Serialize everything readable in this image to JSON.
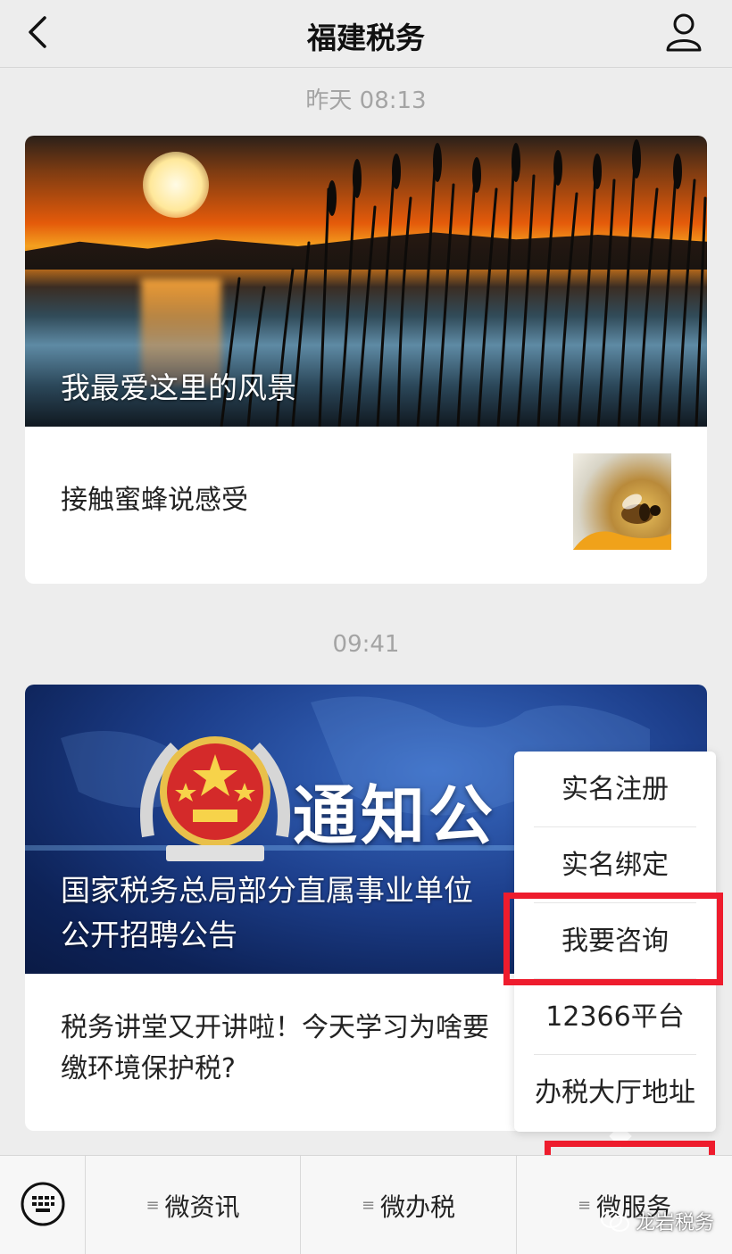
{
  "header": {
    "title": "福建税务",
    "back_icon": "chevron-left-icon",
    "profile_icon": "person-icon"
  },
  "feed": [
    {
      "time": "昨天 08:13",
      "hero_title": "我最爱这里的风景",
      "sub_title": "接触蜜蜂说感受"
    },
    {
      "time": "09:41",
      "hero_title_line1": "国家税务总局部分直属事业单位",
      "hero_title_line2": "公开招聘公告",
      "hero_banner_text": "通知公",
      "sub_title_line1": "税务讲堂又开讲啦！今天学习为啥要",
      "sub_title_line2": "缴环境保护税?"
    }
  ],
  "popup_menu": {
    "items": [
      "实名注册",
      "实名绑定",
      "我要咨询",
      "12366平台",
      "办税大厅地址"
    ],
    "highlighted": "我要咨询"
  },
  "bottom_bar": {
    "keyboard_icon": "keyboard-icon",
    "menus": [
      "微资讯",
      "微办税",
      "微服务"
    ],
    "highlighted": "微服务"
  },
  "watermark": "龙岩税务",
  "colors": {
    "highlight_red": "#ee1c2d",
    "background": "#ededed"
  }
}
